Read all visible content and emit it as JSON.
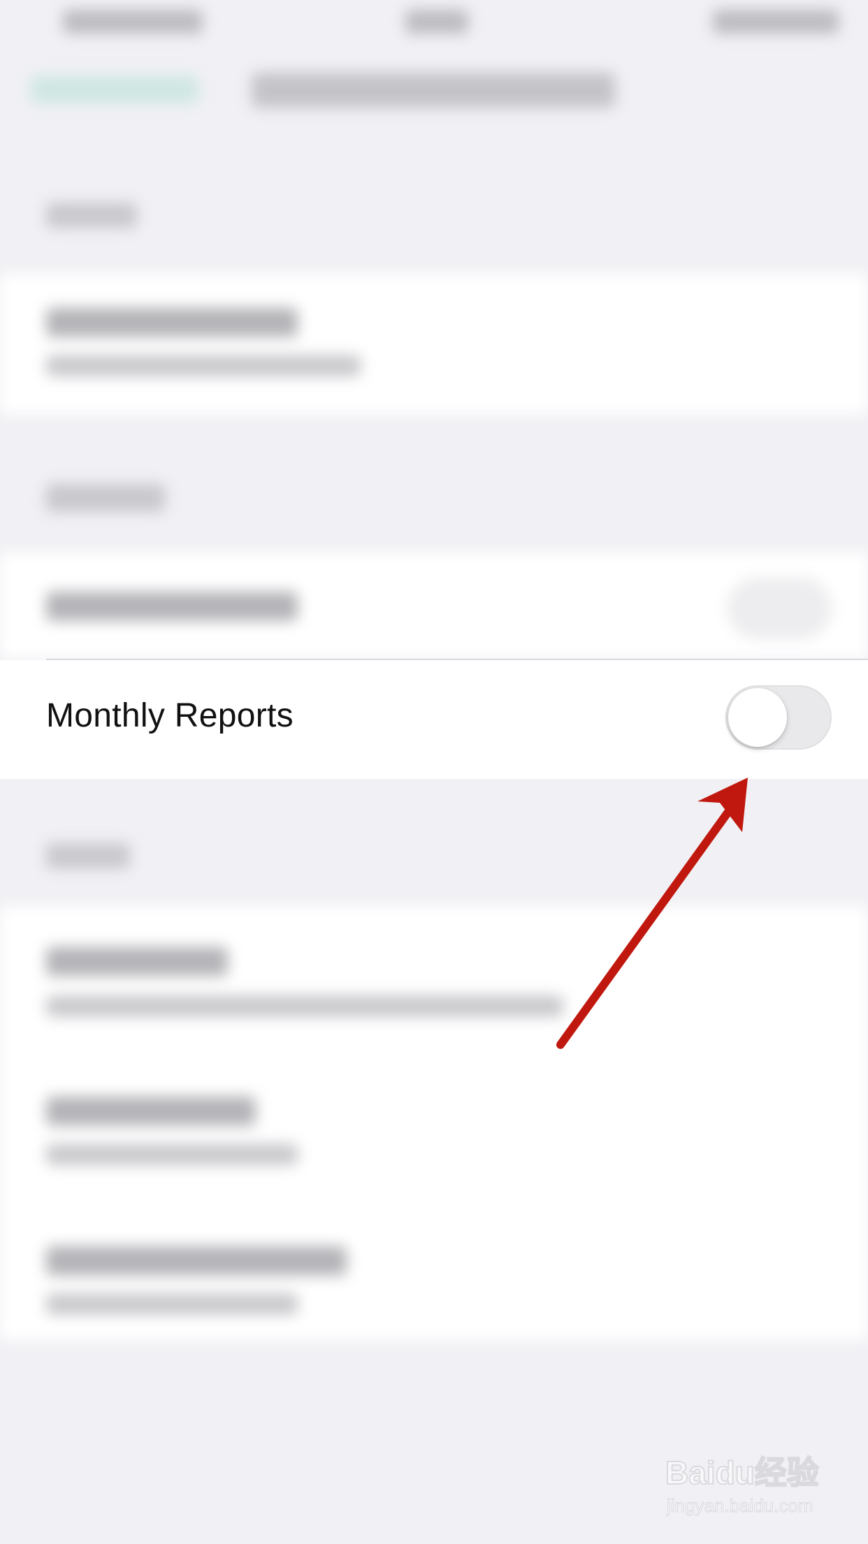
{
  "row": {
    "label": "Monthly Reports",
    "toggle_on": false
  },
  "colors": {
    "background": "#f1f1f5",
    "toggle_off_track": "#e9e9eb",
    "annotation_arrow": "#c0180e",
    "text": "#111111"
  },
  "annotation": {
    "icon": "arrow-icon"
  },
  "watermark": {
    "logo_text": "Baidu经验",
    "url": "jingyan.baidu.com"
  }
}
